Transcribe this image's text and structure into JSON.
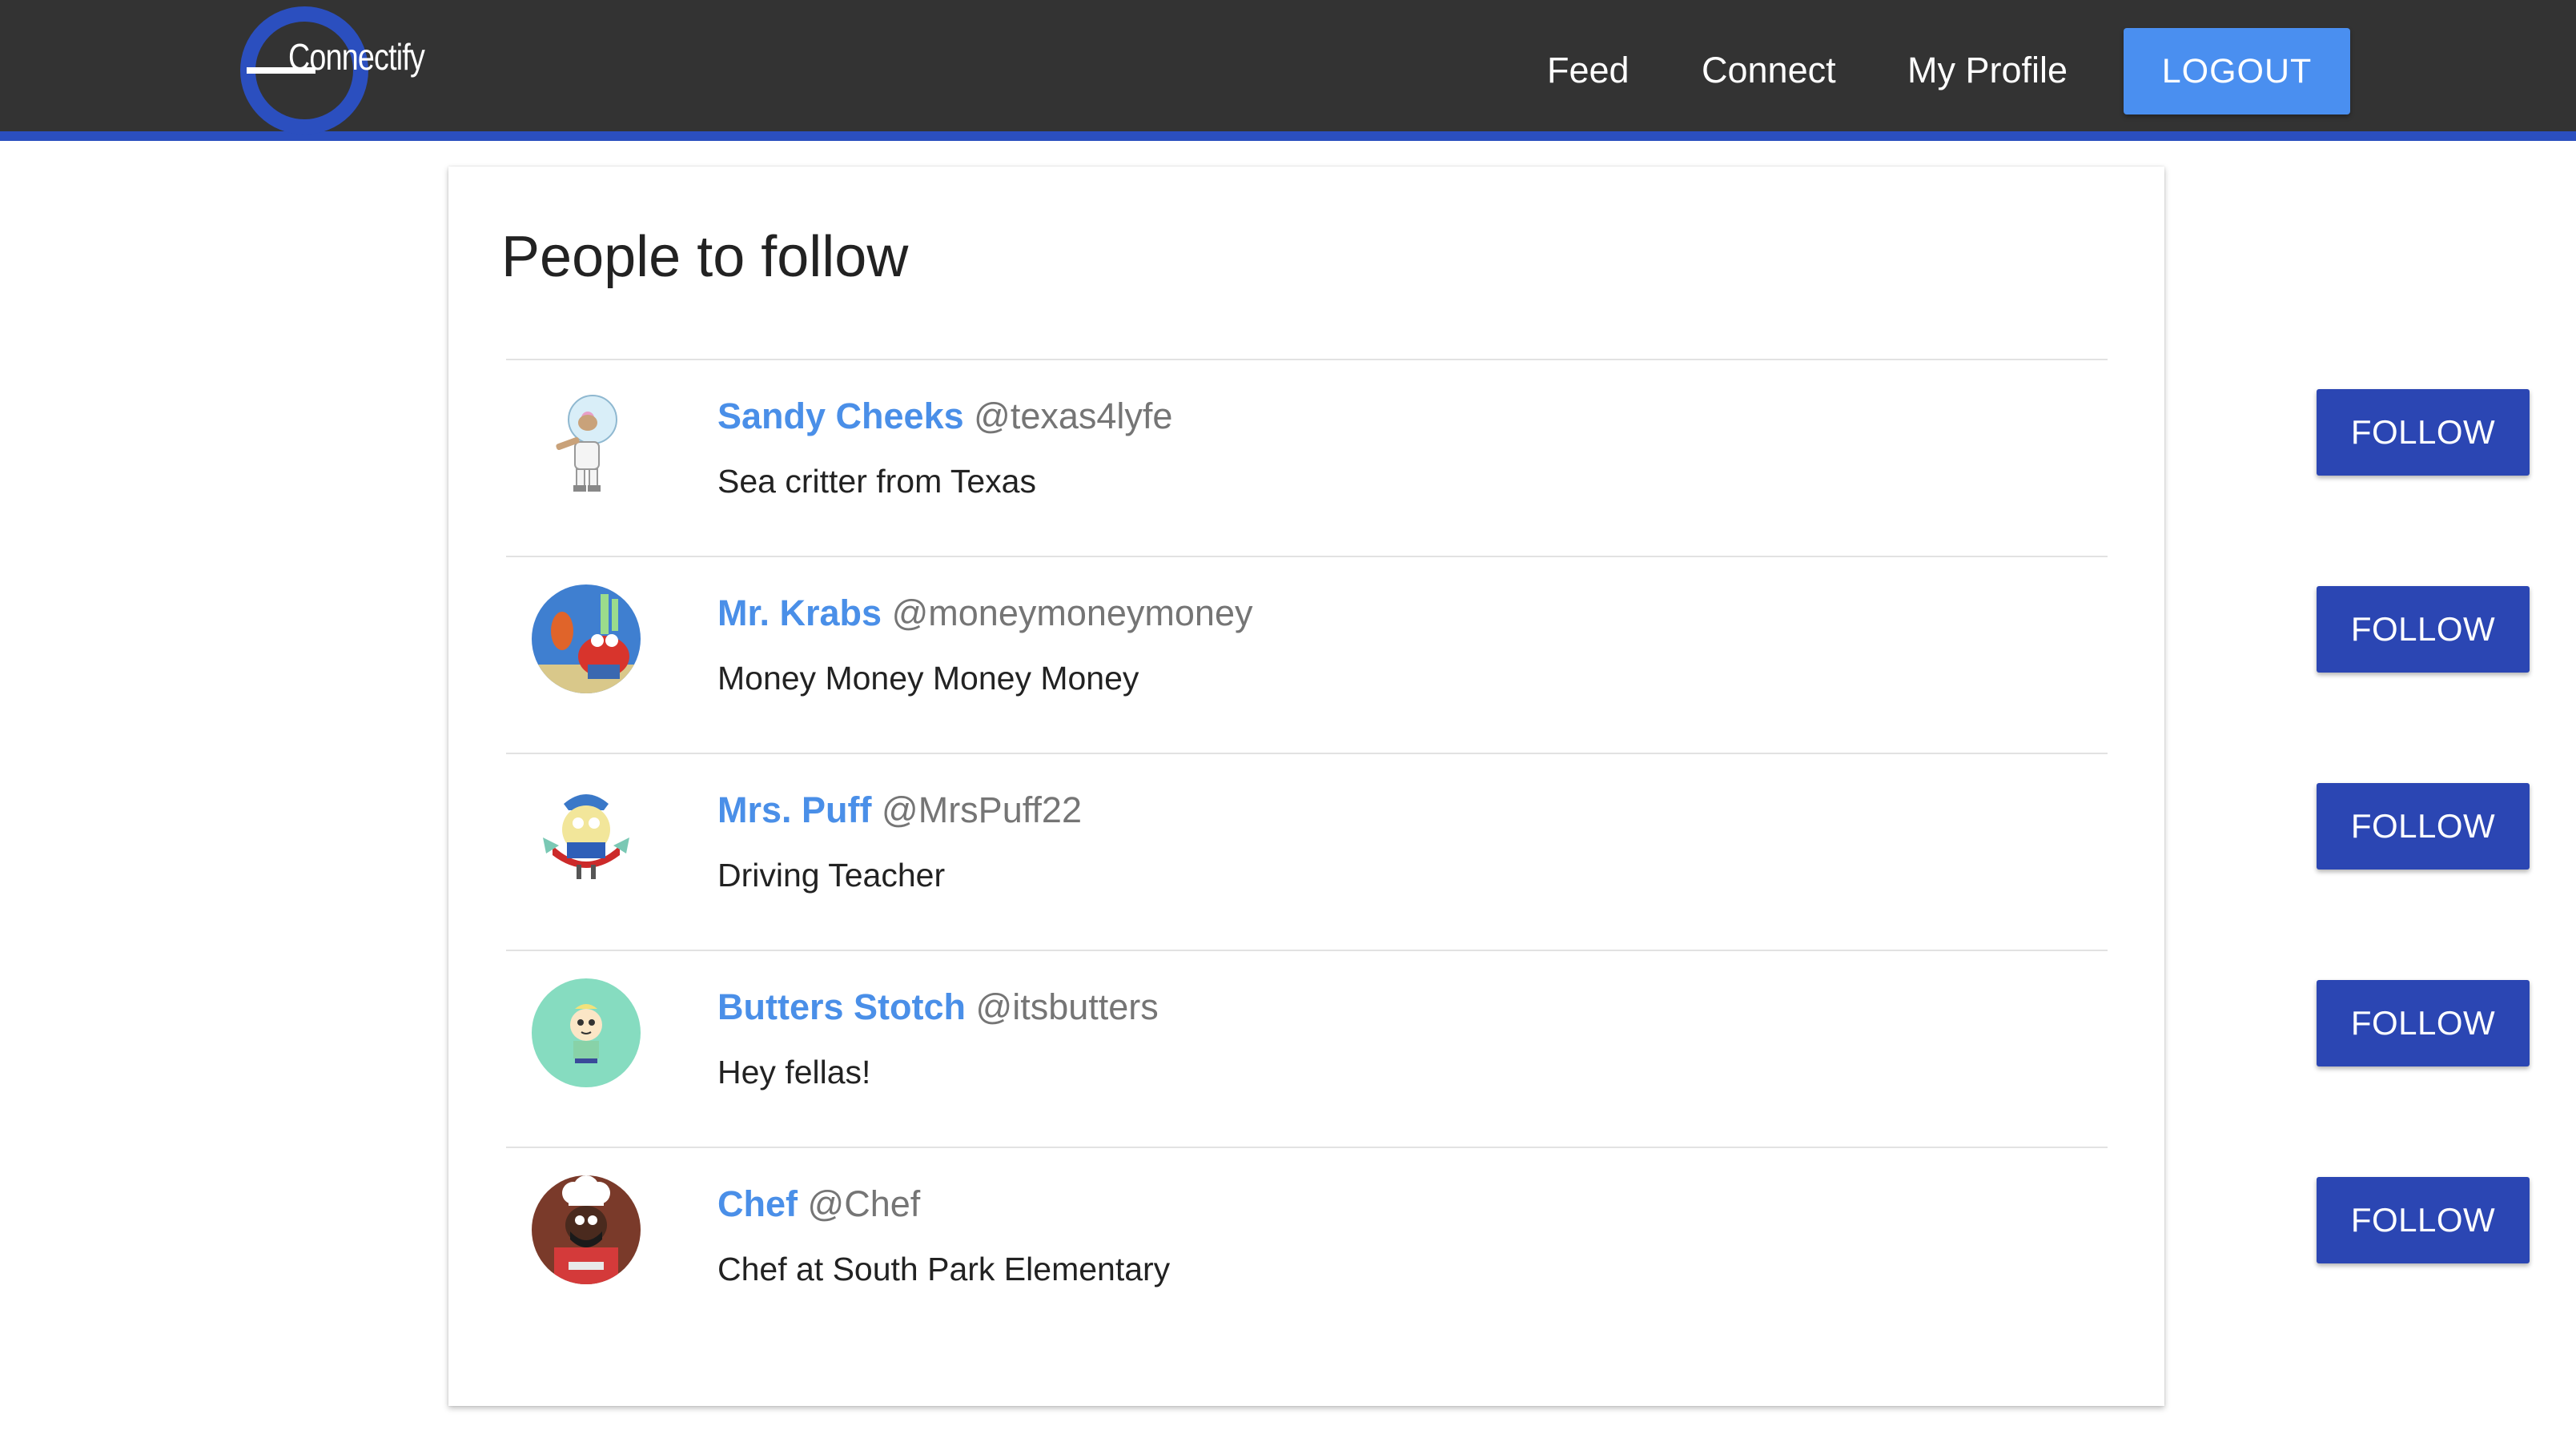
{
  "app": {
    "logo_text": "Connectify",
    "brand_color": "#2b4fbf"
  },
  "nav": {
    "feed": "Feed",
    "connect": "Connect",
    "profile": "My Profile",
    "logout": "LOGOUT"
  },
  "page": {
    "title": "People to follow",
    "follow_label": "FOLLOW"
  },
  "people": [
    {
      "name": "Sandy Cheeks",
      "handle": "@texas4lyfe",
      "bio": "Sea critter from Texas",
      "avatar": "sandy-cheeks-avatar"
    },
    {
      "name": "Mr. Krabs",
      "handle": "@moneymoneymoney",
      "bio": "Money Money Money Money",
      "avatar": "mr-krabs-avatar"
    },
    {
      "name": "Mrs. Puff",
      "handle": "@MrsPuff22",
      "bio": "Driving Teacher",
      "avatar": "mrs-puff-avatar"
    },
    {
      "name": "Butters Stotch",
      "handle": "@itsbutters",
      "bio": "Hey fellas!",
      "avatar": "butters-avatar"
    },
    {
      "name": "Chef",
      "handle": "@Chef",
      "bio": "Chef at South Park Elementary",
      "avatar": "chef-avatar"
    }
  ]
}
